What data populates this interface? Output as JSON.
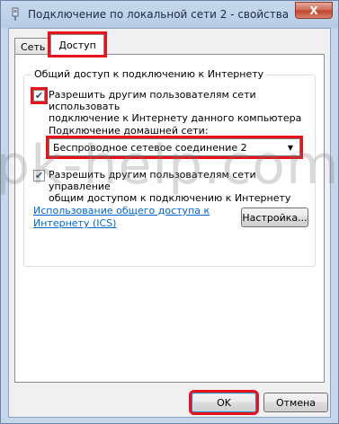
{
  "window": {
    "title": "Подключение по локальной сети 2 - свойства",
    "close_label": "X",
    "icon": "network-adapter-icon"
  },
  "tabs": [
    {
      "label": "Сеть",
      "active": false
    },
    {
      "label": "Доступ",
      "active": true
    }
  ],
  "sharing": {
    "group_title": "Общий доступ к подключению к Интернету",
    "allow_sharing": {
      "checked": true,
      "label_line1": "Разрешить другим пользователям сети использовать",
      "label_line2": "подключение к Интернету данного компьютера"
    },
    "home_network_label": "Подключение домашней сети:",
    "home_network_value": "Беспроводное сетевое соединение 2",
    "allow_control": {
      "checked": true,
      "label_line1": "Разрешить другим пользователям сети управление",
      "label_line2": "общим доступом к подключению к Интернету"
    },
    "ics_link_line1": "Использование общего доступа к",
    "ics_link_line2": "Интернету (ICS)",
    "settings_button": "Настройка..."
  },
  "footer": {
    "ok_label": "OK",
    "cancel_label": "Отмена"
  },
  "watermark": "pk-help.com",
  "colors": {
    "highlight": "#e8121a",
    "link": "#0066cc"
  }
}
